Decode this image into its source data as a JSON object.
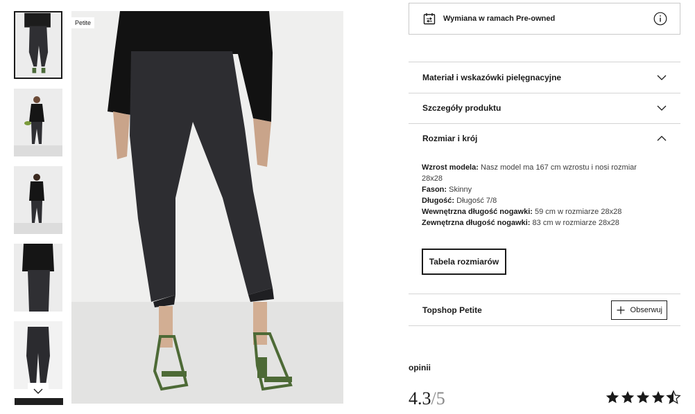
{
  "gallery": {
    "badge": "Petite",
    "thumbnails": [
      "thumb-1",
      "thumb-2",
      "thumb-3",
      "thumb-4",
      "thumb-5"
    ],
    "active_index": 0
  },
  "preowned": {
    "label": "Wymiana w ramach Pre-owned",
    "icons": [
      "calendar-swap-icon",
      "info-icon"
    ]
  },
  "accordions": [
    {
      "title": "Materiał i wskazówki pielęgnacyjne",
      "state": "collapsed"
    },
    {
      "title": "Szczegóły produktu",
      "state": "collapsed"
    },
    {
      "title": "Rozmiar i krój",
      "state": "expanded"
    }
  ],
  "size_fit": {
    "model_height_label": "Wzrost modela:",
    "model_height_value": "Nasz model ma 167 cm wzrostu i nosi rozmiar 28x28",
    "fit_label": "Fason:",
    "fit_value": "Skinny",
    "length_label": "Długość:",
    "length_value": "Długość 7/8",
    "inseam_label": "Wewnętrzna długość nogawki:",
    "inseam_value": "59 cm w rozmiarze 28x28",
    "outseam_label": "Zewnętrzna długość nogawki:",
    "outseam_value": "83 cm w rozmiarze 28x28",
    "size_chart_button": "Tabela rozmiarów"
  },
  "brand": {
    "name": "Topshop Petite",
    "follow_label": "Obserwuj"
  },
  "reviews": {
    "label": "opinii",
    "score": "4.3",
    "max": "/5",
    "stars": 4.5
  },
  "colors": {
    "text": "#1a1a1a",
    "border": "#d4d4d4",
    "muted": "#8a8a8a"
  }
}
